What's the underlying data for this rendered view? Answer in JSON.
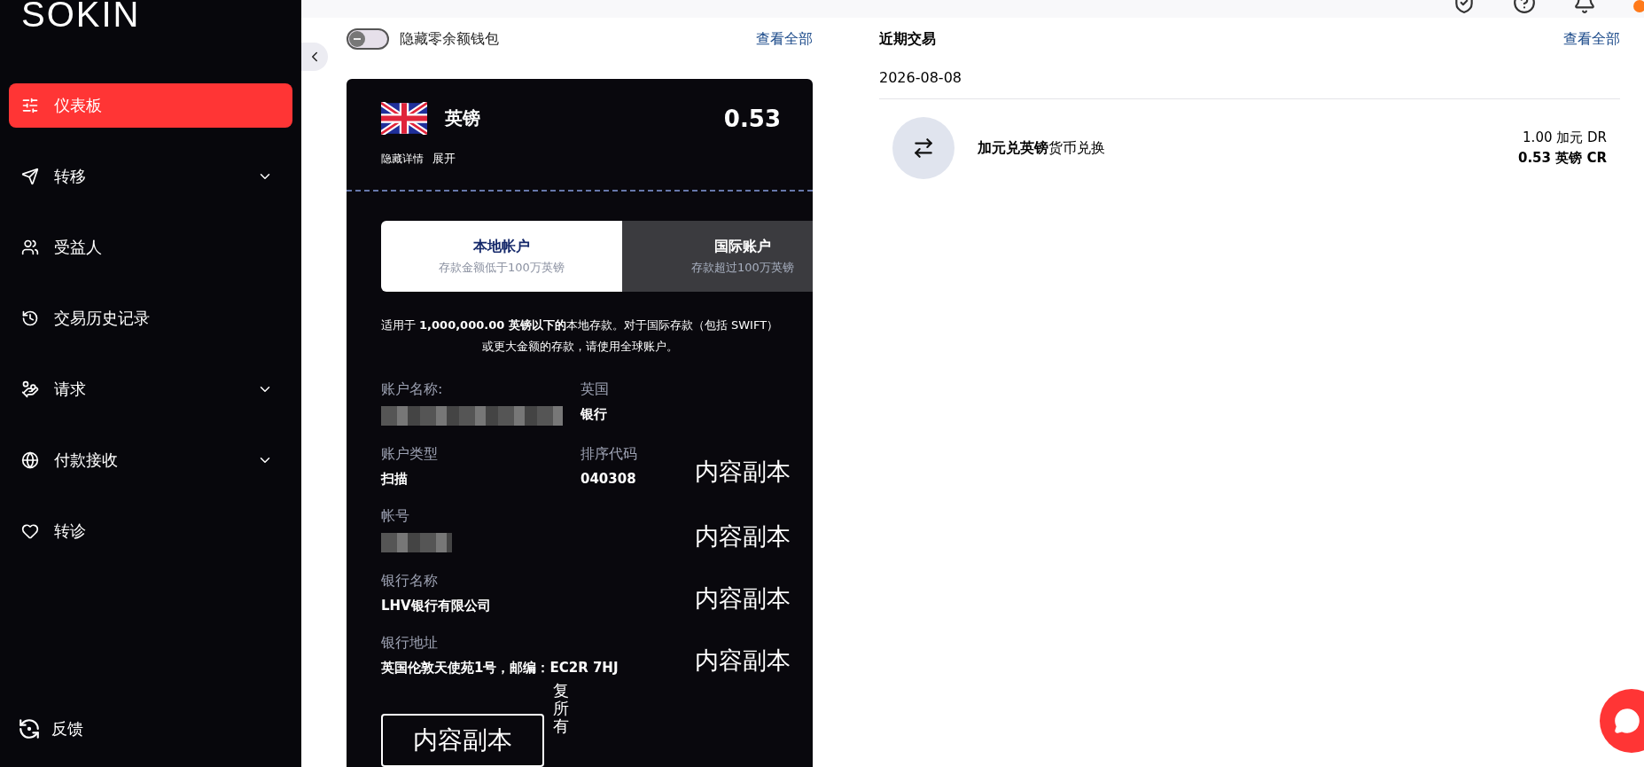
{
  "sidebar": {
    "logo": "SOKIN",
    "items": [
      {
        "label": "仪表板",
        "selected": true,
        "expandable": false
      },
      {
        "label": "转移",
        "selected": false,
        "expandable": true
      },
      {
        "label": "受益人",
        "selected": false,
        "expandable": false
      },
      {
        "label": "交易历史记录",
        "selected": false,
        "expandable": false
      },
      {
        "label": "请求",
        "selected": false,
        "expandable": true
      },
      {
        "label": "付款接收",
        "selected": false,
        "expandable": true
      },
      {
        "label": "转诊",
        "selected": false,
        "expandable": false
      }
    ],
    "footer": "反馈"
  },
  "wallets": {
    "toggle": {
      "label": "隐藏零余额钱包",
      "on": false
    },
    "view_all": "查看全部",
    "card": {
      "currency": "英镑",
      "amount": "0.53",
      "hide_details": "隐藏详情",
      "expand": "展开",
      "tabs": [
        {
          "title": "本地帐户",
          "subtitle": "存款金额低于100万英镑",
          "selected": true
        },
        {
          "title": "国际账户",
          "subtitle": "存款超过100万英镑",
          "selected": false
        }
      ],
      "notice": "适用于 **1,000,000.00 英镑以下的**本地存款。对于国际存款（包括 SWIFT）或更大金额的存款，请使用全球账户。",
      "rows": [
        {
          "cells": [
            {
              "label": "账户名称:",
              "redacted": true
            },
            {
              "label": "英国",
              "value": "银行"
            }
          ]
        },
        {
          "cells": [
            {
              "label": "账户类型",
              "value": "扫描"
            },
            {
              "label": "排序代码",
              "value": "040308"
            }
          ],
          "copy": "内容副本"
        },
        {
          "cells": [
            {
              "label": "帐号",
              "redacted": true
            }
          ],
          "copy": "内容副本"
        },
        {
          "cells": [
            {
              "label": "银行名称",
              "value": "LHV银行有限公司"
            }
          ],
          "copy": "内容副本"
        },
        {
          "cells": [
            {
              "label": "银行地址",
              "value": "英国伦敦天使苑1号，邮编：EC2R 7HJ"
            }
          ],
          "copy": "内容副本"
        }
      ],
      "copy_button": "内容副本",
      "vertical_text": "复所有"
    }
  },
  "recent": {
    "title": "近期交易",
    "view_all": "查看全部",
    "date": "2026-08-08",
    "transactions": [
      {
        "title": "**加元兑英镑**货币兑换",
        "debit": "1.00 加元 DR",
        "credit": "0.53 英镑 CR"
      }
    ]
  }
}
